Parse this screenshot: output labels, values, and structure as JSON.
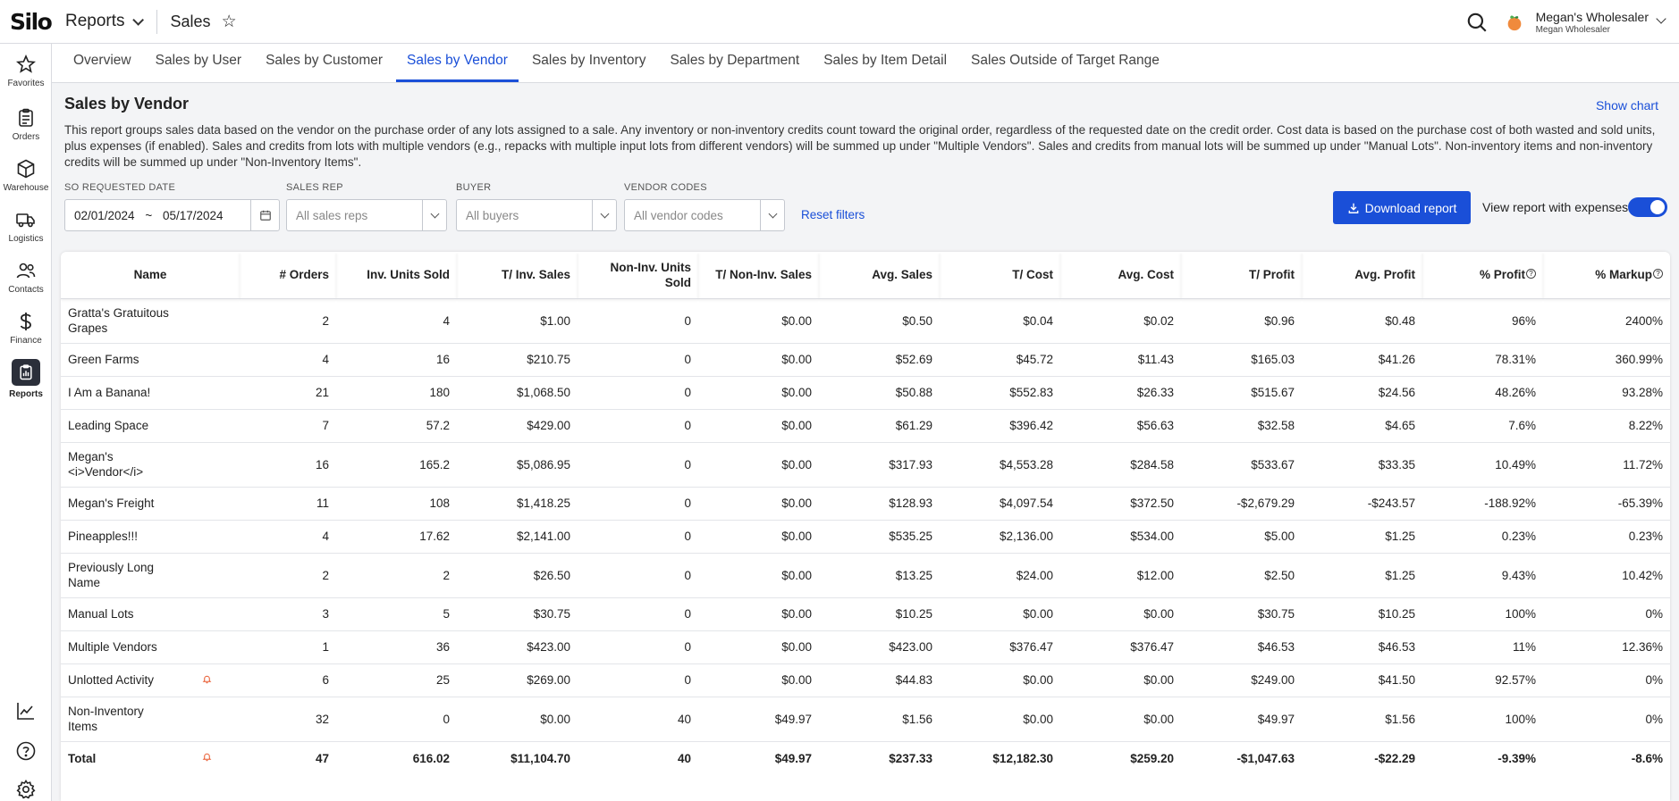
{
  "app": {
    "logo": "Silo",
    "section": "Reports",
    "page": "Sales",
    "account_name": "Megan's Wholesaler",
    "account_sub": "Megan Wholesaler"
  },
  "sidebar": {
    "items": [
      {
        "label": "Favorites",
        "icon": "star-icon"
      },
      {
        "label": "Orders",
        "icon": "clipboard-icon"
      },
      {
        "label": "Warehouse",
        "icon": "box-icon"
      },
      {
        "label": "Logistics",
        "icon": "truck-icon"
      },
      {
        "label": "Contacts",
        "icon": "people-icon"
      },
      {
        "label": "Finance",
        "icon": "dollar-icon"
      },
      {
        "label": "Reports",
        "icon": "report-icon"
      }
    ],
    "bottom_icons": [
      "chart-line-icon",
      "help-circle-icon",
      "gear-icon"
    ]
  },
  "tabs": [
    "Overview",
    "Sales by User",
    "Sales by Customer",
    "Sales by Vendor",
    "Sales by Inventory",
    "Sales by Department",
    "Sales by Item Detail",
    "Sales Outside of Target Range"
  ],
  "active_tab": "Sales by Vendor",
  "report": {
    "title": "Sales by Vendor",
    "show_chart": "Show chart",
    "description": "This report groups sales data based on the vendor on the purchase order of any lots assigned to a sale. Any inventory or non-inventory credits count toward the original order, regardless of the requested date on the credit order. Cost data is based on the purchase cost of both wasted and sold units, plus expenses (if enabled). Sales and credits from lots with multiple vendors (e.g., repacks with multiple input lots from different vendors) will be summed up under \"Multiple Vendors\". Sales and credits from manual lots will be summed up under \"Manual Lots\". Non-inventory items and non-inventory credits will be summed up under \"Non-Inventory Items\"."
  },
  "filters": {
    "date_label": "SO REQUESTED DATE",
    "date_from": "02/01/2024",
    "date_sep": "~",
    "date_to": "05/17/2024",
    "sales_rep_label": "SALES REP",
    "sales_rep_placeholder": "All sales reps",
    "buyer_label": "BUYER",
    "buyer_placeholder": "All buyers",
    "vendor_codes_label": "VENDOR CODES",
    "vendor_codes_placeholder": "All vendor codes",
    "reset": "Reset filters",
    "download": "Download report",
    "expenses_toggle": "View report with expenses"
  },
  "table": {
    "headers": [
      "Name",
      "# Orders",
      "Inv. Units Sold",
      "T/ Inv. Sales",
      "Non-Inv. Units Sold",
      "T/ Non-Inv. Sales",
      "Avg. Sales",
      "T/ Cost",
      "Avg. Cost",
      "T/ Profit",
      "Avg. Profit",
      "% Profit",
      "% Markup"
    ],
    "rows": [
      {
        "name": "Gratta's Gratuitous Grapes",
        "cells": [
          "2",
          "4",
          "$1.00",
          "0",
          "$0.00",
          "$0.50",
          "$0.04",
          "$0.02",
          "$0.96",
          "$0.48",
          "96%",
          "2400%"
        ]
      },
      {
        "name": "Green Farms",
        "cells": [
          "4",
          "16",
          "$210.75",
          "0",
          "$0.00",
          "$52.69",
          "$45.72",
          "$11.43",
          "$165.03",
          "$41.26",
          "78.31%",
          "360.99%"
        ]
      },
      {
        "name": "I Am a Banana!",
        "cells": [
          "21",
          "180",
          "$1,068.50",
          "0",
          "$0.00",
          "$50.88",
          "$552.83",
          "$26.33",
          "$515.67",
          "$24.56",
          "48.26%",
          "93.28%"
        ]
      },
      {
        "name": "Leading Space",
        "cells": [
          "7",
          "57.2",
          "$429.00",
          "0",
          "$0.00",
          "$61.29",
          "$396.42",
          "$56.63",
          "$32.58",
          "$4.65",
          "7.6%",
          "8.22%"
        ]
      },
      {
        "name": "Megan's <i>Vendor</i>",
        "cells": [
          "16",
          "165.2",
          "$5,086.95",
          "0",
          "$0.00",
          "$317.93",
          "$4,553.28",
          "$284.58",
          "$533.67",
          "$33.35",
          "10.49%",
          "11.72%"
        ]
      },
      {
        "name": "Megan's Freight",
        "cells": [
          "11",
          "108",
          "$1,418.25",
          "0",
          "$0.00",
          "$128.93",
          "$4,097.54",
          "$372.50",
          "-$2,679.29",
          "-$243.57",
          "-188.92%",
          "-65.39%"
        ]
      },
      {
        "name": "Pineapples!!!",
        "cells": [
          "4",
          "17.62",
          "$2,141.00",
          "0",
          "$0.00",
          "$535.25",
          "$2,136.00",
          "$534.00",
          "$5.00",
          "$1.25",
          "0.23%",
          "0.23%"
        ]
      },
      {
        "name": "Previously Long Name",
        "cells": [
          "2",
          "2",
          "$26.50",
          "0",
          "$0.00",
          "$13.25",
          "$24.00",
          "$12.00",
          "$2.50",
          "$1.25",
          "9.43%",
          "10.42%"
        ]
      },
      {
        "name": "Manual Lots",
        "cells": [
          "3",
          "5",
          "$30.75",
          "0",
          "$0.00",
          "$10.25",
          "$0.00",
          "$0.00",
          "$30.75",
          "$10.25",
          "100%",
          "0%"
        ]
      },
      {
        "name": "Multiple Vendors",
        "cells": [
          "1",
          "36",
          "$423.00",
          "0",
          "$0.00",
          "$423.00",
          "$376.47",
          "$376.47",
          "$46.53",
          "$46.53",
          "11%",
          "12.36%"
        ]
      },
      {
        "name": "Unlotted Activity",
        "alert": true,
        "cells": [
          "6",
          "25",
          "$269.00",
          "0",
          "$0.00",
          "$44.83",
          "$0.00",
          "$0.00",
          "$249.00",
          "$41.50",
          "92.57%",
          "0%"
        ]
      },
      {
        "name": "Non-Inventory Items",
        "cells": [
          "32",
          "0",
          "$0.00",
          "40",
          "$49.97",
          "$1.56",
          "$0.00",
          "$0.00",
          "$49.97",
          "$1.56",
          "100%",
          "0%"
        ]
      }
    ],
    "total": {
      "name": "Total",
      "alert": true,
      "cells": [
        "47",
        "616.02",
        "$11,104.70",
        "40",
        "$49.97",
        "$237.33",
        "$12,182.30",
        "$259.20",
        "-$1,047.63",
        "-$22.29",
        "-9.39%",
        "-8.6%"
      ]
    }
  },
  "colors": {
    "accent": "#1a4fd8",
    "alert": "#e8562a"
  }
}
